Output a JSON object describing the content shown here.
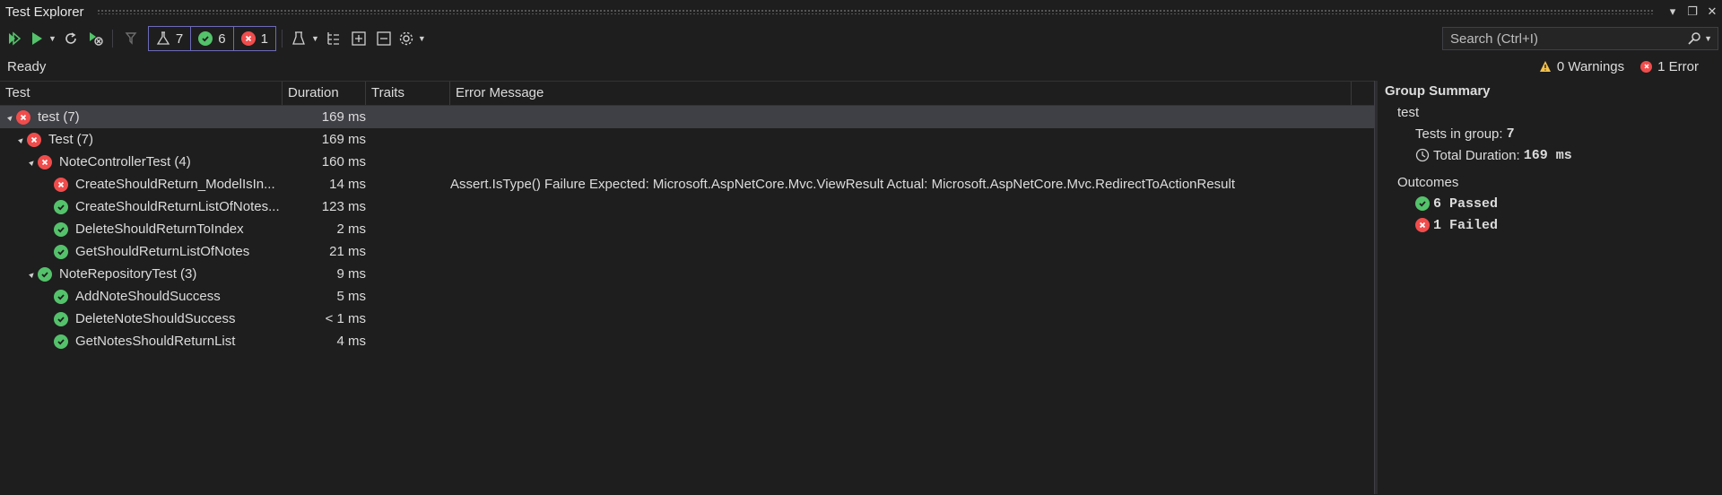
{
  "window": {
    "title": "Test Explorer"
  },
  "toolbar": {
    "counts": {
      "total": "7",
      "passed": "6",
      "failed": "1"
    },
    "search_placeholder": "Search (Ctrl+I)"
  },
  "status": {
    "text": "Ready",
    "warnings": "0 Warnings",
    "errors": "1 Error"
  },
  "grid": {
    "headers": {
      "test": "Test",
      "duration": "Duration",
      "traits": "Traits",
      "error": "Error Message"
    },
    "rows": [
      {
        "name": "test  (7)",
        "duration": "169 ms",
        "error": "",
        "status": "fail",
        "level": 0,
        "expand": "▲"
      },
      {
        "name": "Test  (7)",
        "duration": "169 ms",
        "error": "",
        "status": "fail",
        "level": 1,
        "expand": "▲"
      },
      {
        "name": "NoteControllerTest  (4)",
        "duration": "160 ms",
        "error": "",
        "status": "fail",
        "level": 2,
        "expand": "▲"
      },
      {
        "name": "CreateShouldReturn_ModelIsIn...",
        "duration": "14 ms",
        "error": "Assert.IsType() Failure Expected: Microsoft.AspNetCore.Mvc.ViewResult Actual:   Microsoft.AspNetCore.Mvc.RedirectToActionResult",
        "status": "fail",
        "level": 3,
        "expand": ""
      },
      {
        "name": "CreateShouldReturnListOfNotes...",
        "duration": "123 ms",
        "error": "",
        "status": "pass",
        "level": 3,
        "expand": ""
      },
      {
        "name": "DeleteShouldReturnToIndex",
        "duration": "2 ms",
        "error": "",
        "status": "pass",
        "level": 3,
        "expand": ""
      },
      {
        "name": "GetShouldReturnListOfNotes",
        "duration": "21 ms",
        "error": "",
        "status": "pass",
        "level": 3,
        "expand": ""
      },
      {
        "name": "NoteRepositoryTest  (3)",
        "duration": "9 ms",
        "error": "",
        "status": "pass",
        "level": 2,
        "expand": "▲"
      },
      {
        "name": "AddNoteShouldSuccess",
        "duration": "5 ms",
        "error": "",
        "status": "pass",
        "level": 3,
        "expand": ""
      },
      {
        "name": "DeleteNoteShouldSuccess",
        "duration": "< 1 ms",
        "error": "",
        "status": "pass",
        "level": 3,
        "expand": ""
      },
      {
        "name": "GetNotesShouldReturnList",
        "duration": "4 ms",
        "error": "",
        "status": "pass",
        "level": 3,
        "expand": ""
      }
    ]
  },
  "summary": {
    "title": "Group Summary",
    "group": "test",
    "tests_label": "Tests in group:",
    "tests_value": "7",
    "duration_label": "Total Duration:",
    "duration_value": "169 ms",
    "outcomes_label": "Outcomes",
    "passed": "6 Passed",
    "failed": "1 Failed"
  },
  "colors": {
    "pass": "#54c26b",
    "fail": "#f14c4c",
    "selected": "#3f3f46"
  }
}
